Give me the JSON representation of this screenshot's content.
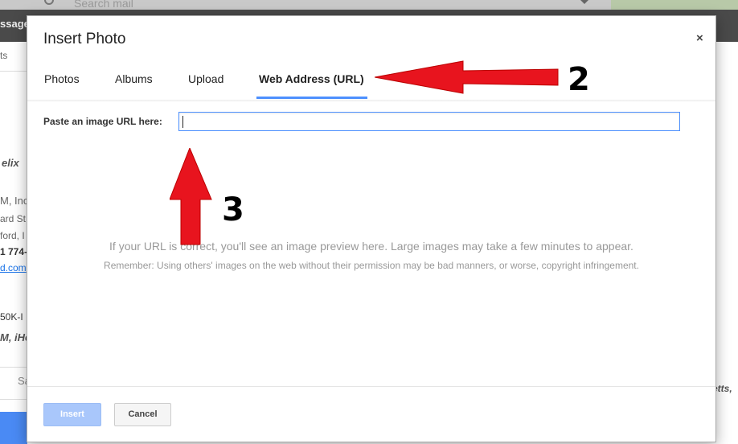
{
  "background": {
    "search_placeholder": "Search mail",
    "header_fragment": "ssage",
    "left_fragments": [
      "ts",
      "elix",
      "M, Inc",
      "ard St",
      "ford, I",
      "1 774-",
      "d.com",
      "50K-I",
      "M, iHe",
      "Sa"
    ],
    "right_fragment": "etts,"
  },
  "dialog": {
    "title": "Insert Photo",
    "close_label": "×",
    "tabs": [
      {
        "label": "Photos"
      },
      {
        "label": "Albums"
      },
      {
        "label": "Upload"
      },
      {
        "label": "Web Address (URL)"
      }
    ],
    "url_label": "Paste an image URL here:",
    "url_value": "",
    "url_placeholder": "",
    "preview_message": "If your URL is correct, you'll see an image preview here. Large images may take a few minutes to appear.",
    "remember_message": "Remember: Using others' images on the web without their permission may be bad manners, or worse, copyright infringement.",
    "insert_label": "Insert",
    "cancel_label": "Cancel"
  },
  "annotations": {
    "step2_label": "2",
    "step3_label": "3",
    "arrow_color": "#e8141e"
  },
  "colors": {
    "accent": "#4d90fe",
    "insert_disabled": "#a9c7fb"
  }
}
